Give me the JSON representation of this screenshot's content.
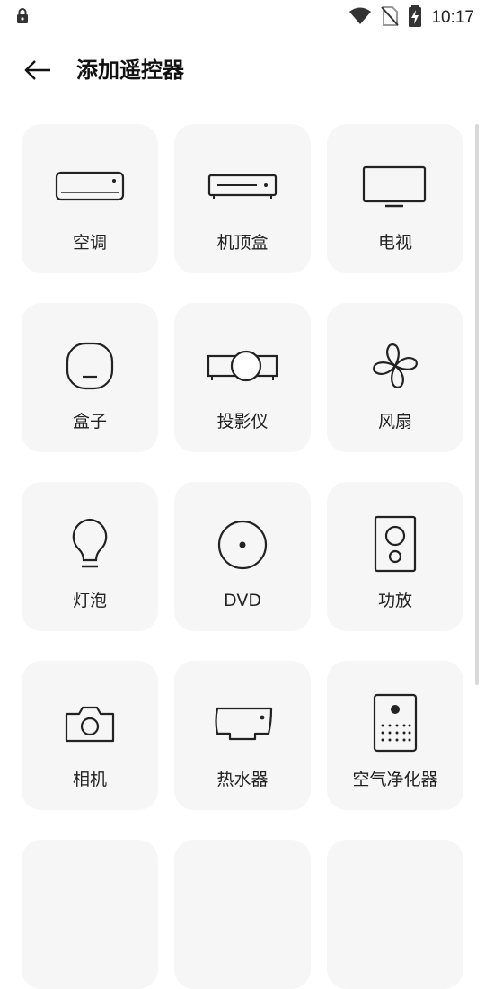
{
  "status_bar": {
    "time": "10:17",
    "icons": [
      "lock-icon",
      "wifi-icon",
      "no-sim-icon",
      "battery-charging-icon"
    ]
  },
  "header": {
    "back_icon": "arrow-left-icon",
    "title": "添加遥控器"
  },
  "devices": [
    {
      "label": "空调",
      "icon": "air-conditioner-icon"
    },
    {
      "label": "机顶盒",
      "icon": "set-top-box-icon"
    },
    {
      "label": "电视",
      "icon": "tv-icon"
    },
    {
      "label": "盒子",
      "icon": "box-icon"
    },
    {
      "label": "投影仪",
      "icon": "projector-icon"
    },
    {
      "label": "风扇",
      "icon": "fan-icon"
    },
    {
      "label": "灯泡",
      "icon": "light-bulb-icon"
    },
    {
      "label": "DVD",
      "icon": "dvd-icon"
    },
    {
      "label": "功放",
      "icon": "amplifier-icon"
    },
    {
      "label": "相机",
      "icon": "camera-icon"
    },
    {
      "label": "热水器",
      "icon": "water-heater-icon"
    },
    {
      "label": "空气净化器",
      "icon": "air-purifier-icon"
    },
    {
      "label": "",
      "icon": ""
    },
    {
      "label": "",
      "icon": ""
    },
    {
      "label": "",
      "icon": ""
    }
  ]
}
